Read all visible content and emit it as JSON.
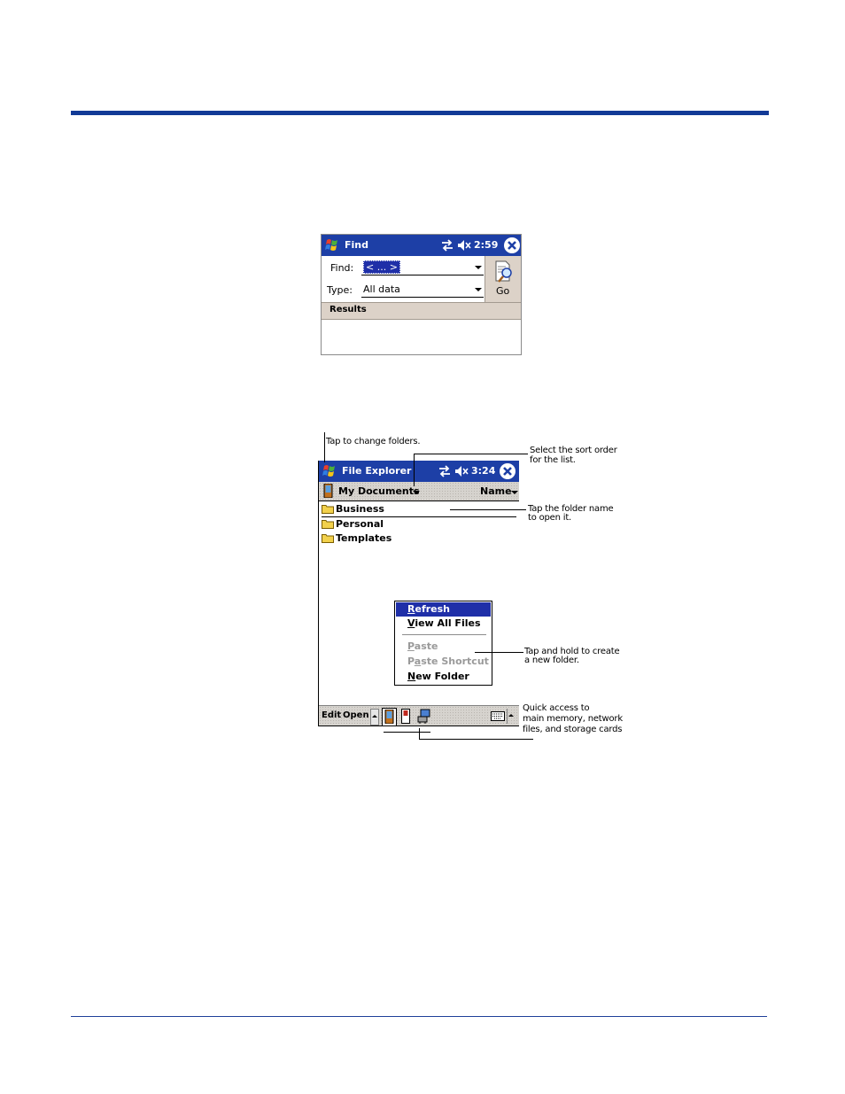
{
  "find_window": {
    "title": "Find",
    "time": "2:59",
    "find_label": "Find:",
    "find_value": "< ... >",
    "type_label": "Type:",
    "type_value": "All data",
    "go_label": "Go",
    "results_label": "Results"
  },
  "explorer_window": {
    "title": "File Explorer",
    "time": "3:24",
    "folder_path": "My Documents",
    "sort_label": "Name",
    "folders": [
      "Business",
      "Personal",
      "Templates"
    ],
    "context_menu": [
      {
        "label": "Refresh",
        "accel": "R",
        "rest": "efresh",
        "state": "selected"
      },
      {
        "label": "View All Files",
        "accel": "V",
        "rest": "iew All Files",
        "state": "enabled"
      },
      {
        "label": "Paste",
        "accel": "P",
        "rest": "aste",
        "state": "disabled"
      },
      {
        "label": "Paste Shortcut",
        "accel": "a",
        "pre": "P",
        "rest": "ste Shortcut",
        "state": "disabled"
      },
      {
        "label": "New Folder",
        "accel": "N",
        "rest": "ew Folder",
        "state": "enabled"
      }
    ],
    "toolbar": {
      "edit": "Edit",
      "open": "Open"
    }
  },
  "callouts": {
    "change_folders": "Tap to change folders.",
    "sort_order_1": "Select the sort order",
    "sort_order_2": "for the list.",
    "open_folder_1": "Tap the folder name",
    "open_folder_2": "to open it.",
    "new_folder_1": "Tap and hold to create",
    "new_folder_2": "a new folder.",
    "quick_access_1": "Quick access to",
    "quick_access_2": "main memory, network",
    "quick_access_3": "files, and storage cards"
  },
  "colors": {
    "title_bar": "#1d3fa6",
    "rule": "#123a96",
    "menu_highlight": "#1f2fa8"
  }
}
